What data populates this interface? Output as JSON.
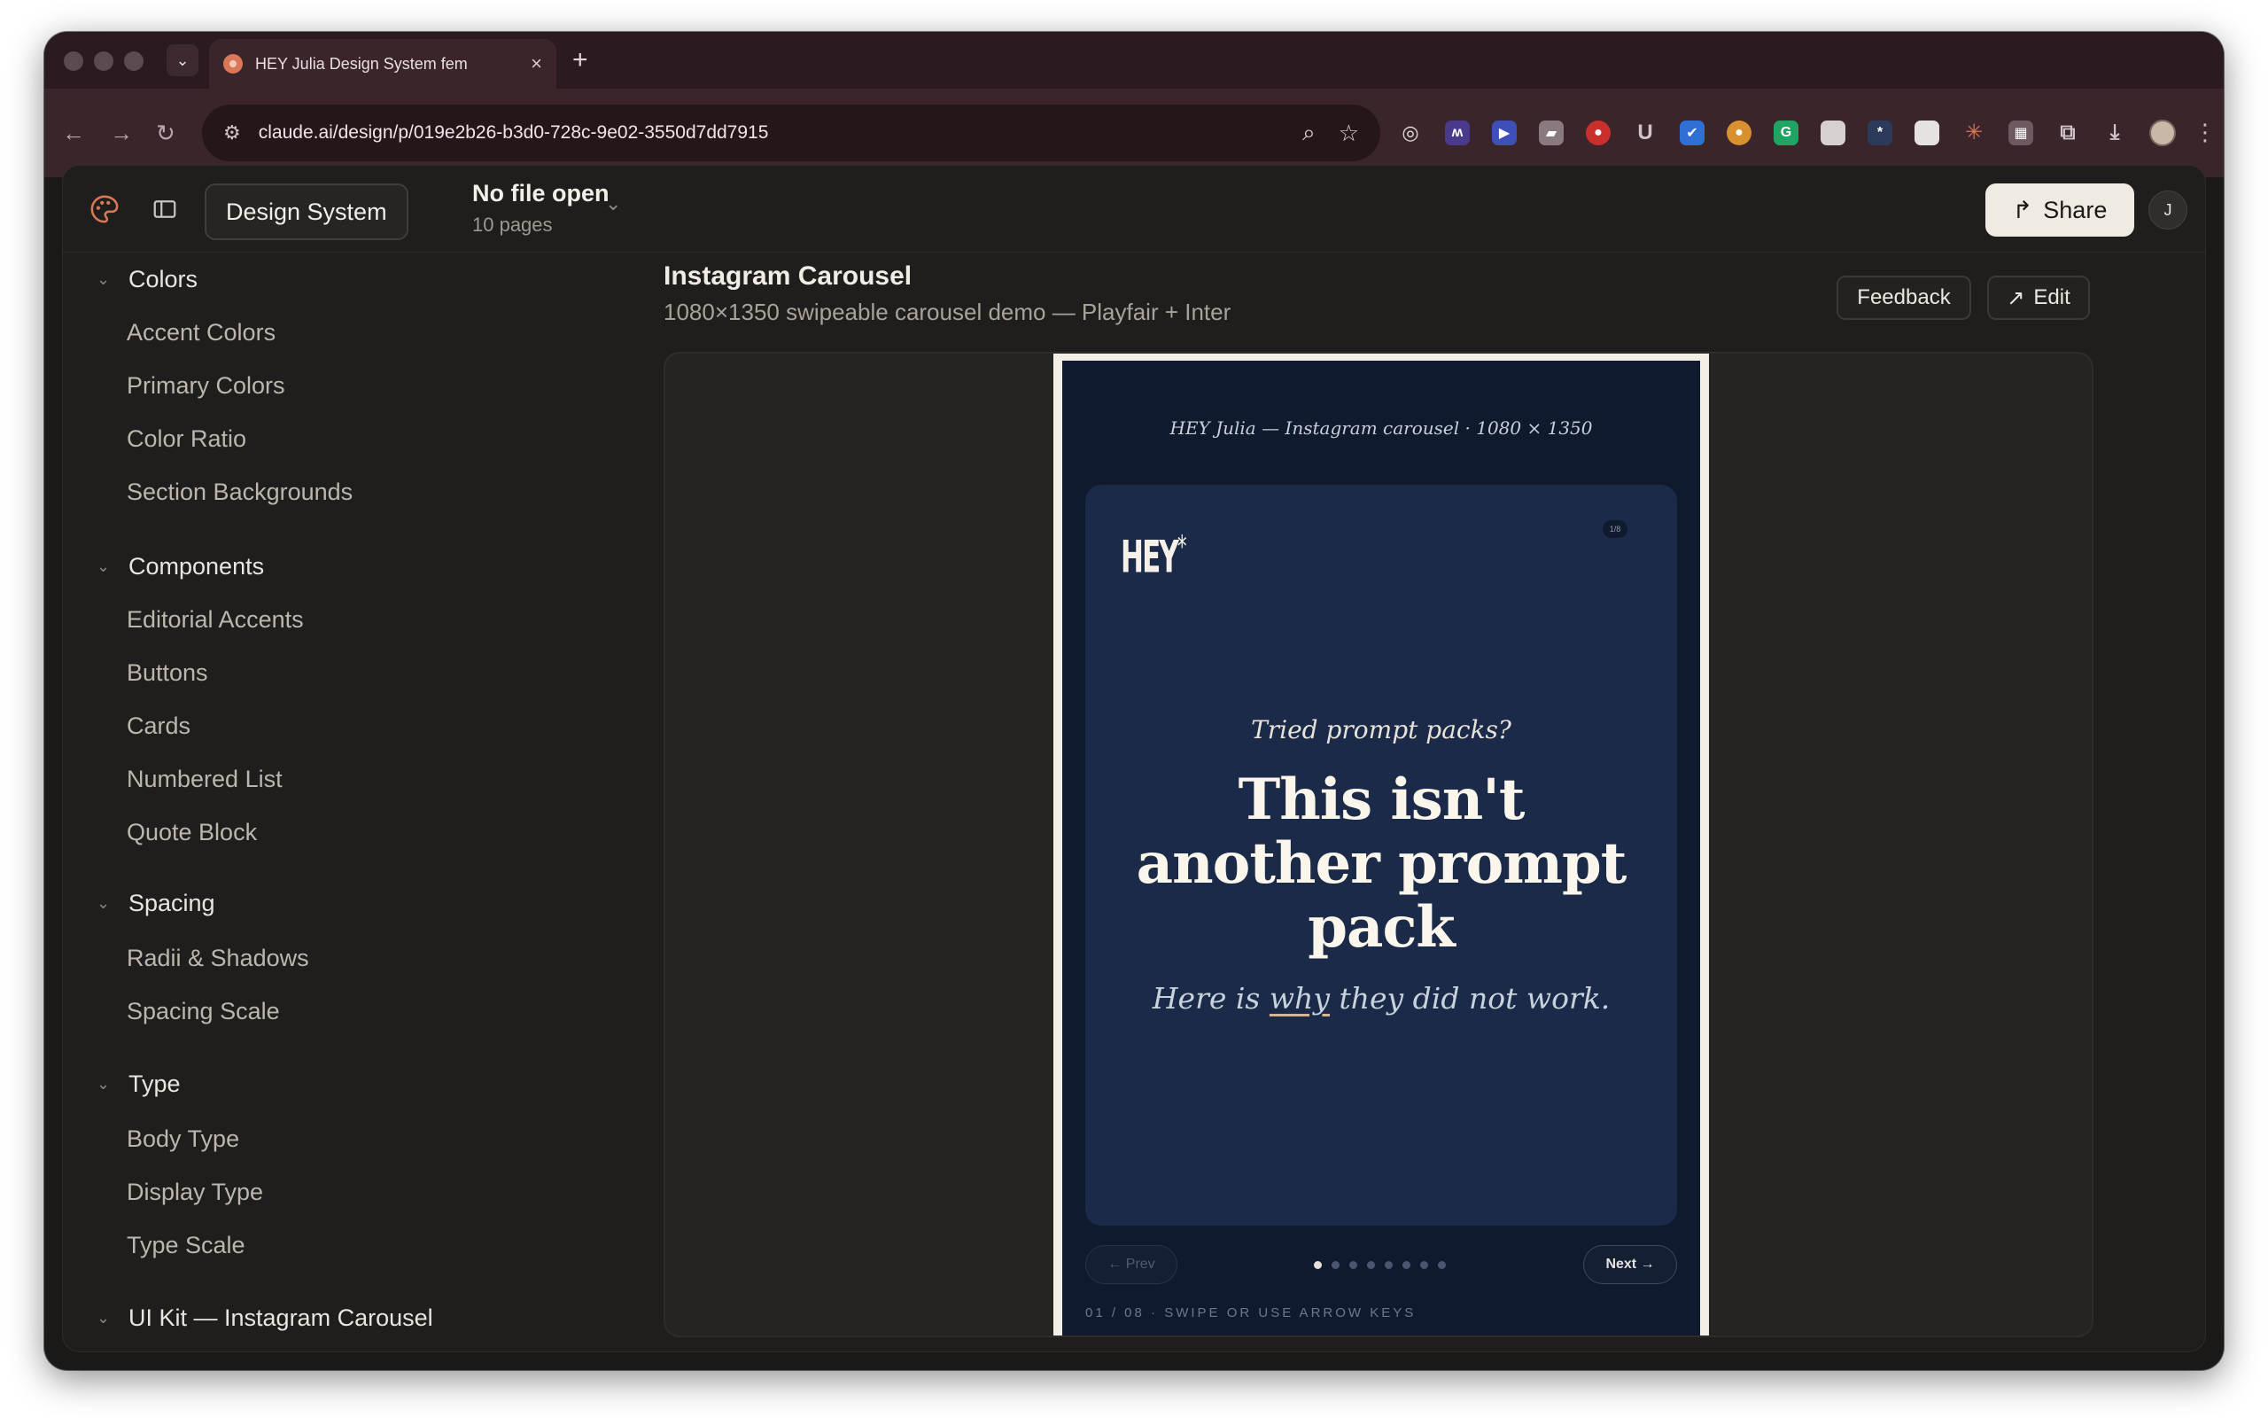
{
  "browser": {
    "tab_title": "HEY Julia Design System fem",
    "url": "claude.ai/design/p/019e2b26-b3d0-728c-9e02-3550d7dd7915"
  },
  "header": {
    "project_button": "Design System",
    "file_title": "No file open",
    "file_subtitle": "10 pages",
    "share_label": "Share",
    "user_initial": "J"
  },
  "sidebar": {
    "sections": [
      {
        "title": "Colors",
        "items": [
          "Accent Colors",
          "Primary Colors",
          "Color Ratio",
          "Section Backgrounds"
        ]
      },
      {
        "title": "Components",
        "items": [
          "Editorial Accents",
          "Buttons",
          "Cards",
          "Numbered List",
          "Quote Block"
        ]
      },
      {
        "title": "Spacing",
        "items": [
          "Radii & Shadows",
          "Spacing Scale"
        ]
      },
      {
        "title": "Type",
        "items": [
          "Body Type",
          "Display Type",
          "Type Scale"
        ]
      },
      {
        "title": "UI Kit — Instagram Carousel",
        "items": []
      }
    ]
  },
  "main": {
    "title": "Instagram Carousel",
    "subtitle": "1080×1350 swipeable carousel demo — Playfair + Inter",
    "feedback_label": "Feedback",
    "edit_label": "Edit"
  },
  "preview": {
    "caption": "HEY Julia — Instagram carousel · 1080 × 1350",
    "logo": "HEY",
    "logo_mark": "*",
    "counter": "1/8",
    "kicker": "Tried prompt packs?",
    "headline": "This isn't another prompt pack",
    "tagline_before": "Here is ",
    "tagline_emphasis": "why",
    "tagline_after": " they did not work.",
    "prev_label": "← Prev",
    "next_label": "Next →",
    "active_slide": 1,
    "total_slides": 8,
    "footer": "01 / 08 · SWIPE OR USE ARROW KEYS"
  },
  "colors": {
    "accent": "#d97757",
    "slide_bg": "#1b2a48",
    "phone_bg": "#0f1a2e"
  }
}
